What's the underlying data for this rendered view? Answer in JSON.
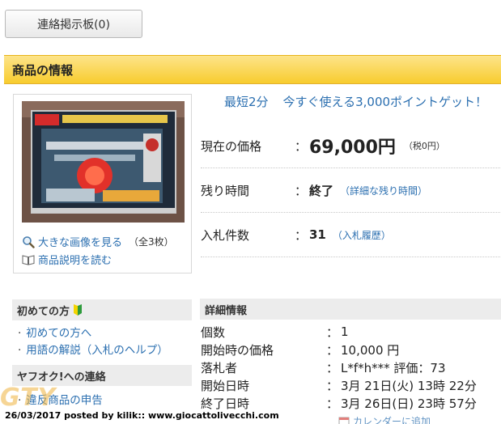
{
  "board_button": "連絡掲示板(0)",
  "section_title": "商品の情報",
  "image_links": {
    "large_image": "大きな画像を見る",
    "image_count": "（全3枚）",
    "description": "商品説明を読む"
  },
  "promo": {
    "shortest": "最短2分",
    "points": "今すぐ使える3,000ポイントゲット！"
  },
  "price": {
    "label": "現在の価格",
    "colon": "：",
    "value": "69,000円",
    "tax": "（税0円）"
  },
  "remaining": {
    "label": "残り時間",
    "colon": "：",
    "value": "終了",
    "link": "（詳細な残り時間）"
  },
  "bids": {
    "label": "入札件数",
    "colon": "：",
    "value": "31",
    "link": "（入札履歴）"
  },
  "beginner": {
    "title": "初めての方",
    "links": [
      "初めての方へ",
      "用語の解説（入札のヘルプ）"
    ]
  },
  "contact": {
    "title": "ヤフオク!への連絡",
    "links": [
      "違反商品の申告"
    ]
  },
  "details": {
    "title": "詳細情報",
    "rows": [
      {
        "key": "個数",
        "value": "1"
      },
      {
        "key": "開始時の価格",
        "value": "10,000 円"
      },
      {
        "key": "落札者",
        "value": "L*f*h*** 評価：73"
      },
      {
        "key": "開始日時",
        "value": "3月 21日(火) 13時 22分"
      },
      {
        "key": "終了日時",
        "value": "3月 26日(日) 23時 57分"
      }
    ],
    "colon": "："
  },
  "calendar_link": "カレンダーに追加",
  "watermark_logo": "GTY",
  "footer_credit": "26/03/2017 posted by kilik:: www.giocattolivecchi.com",
  "colors": {
    "link": "#2b6fb0",
    "header_yellow": "#f8cc2e",
    "beginner_mark": "#2e9b3c"
  }
}
